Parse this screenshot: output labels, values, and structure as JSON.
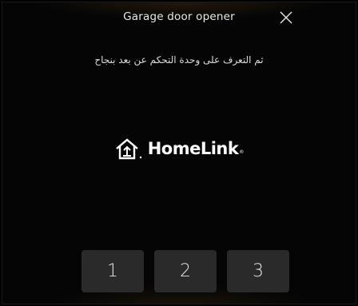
{
  "header": {
    "title": "Garage door opener",
    "close_icon": "close-icon"
  },
  "subtitle": "ثم التعرف على وحدة التحكم عن بعد بنجاح",
  "logo": {
    "brand": "HomeLink",
    "registered": "®",
    "icon": "homelink-house-icon"
  },
  "channels": [
    {
      "label": "1"
    },
    {
      "label": "2"
    },
    {
      "label": "3"
    }
  ]
}
